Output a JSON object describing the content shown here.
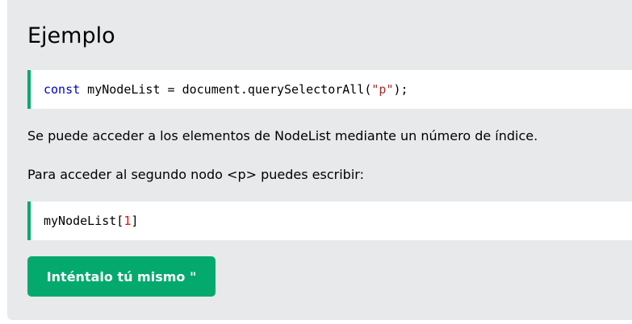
{
  "example": {
    "heading": "Ejemplo",
    "code1": {
      "keyword": "const",
      "before_string": " myNodeList = document.querySelectorAll(",
      "string": "\"p\"",
      "after_string": ");"
    },
    "paragraph1": "Se puede acceder a los elementos de NodeList mediante un número de índice.",
    "paragraph2": "Para acceder al segundo nodo <p> puedes escribir:",
    "code2": {
      "before_number": "myNodeList[",
      "number": "1",
      "after_number": "]"
    },
    "try_button_label": "Inténtalo tú mismo \""
  },
  "colors": {
    "accent": "#04aa6d",
    "panel_background": "#e7e9eb",
    "keyword": "#0000cd",
    "string": "#a52a2a",
    "number": "#ff0000"
  }
}
